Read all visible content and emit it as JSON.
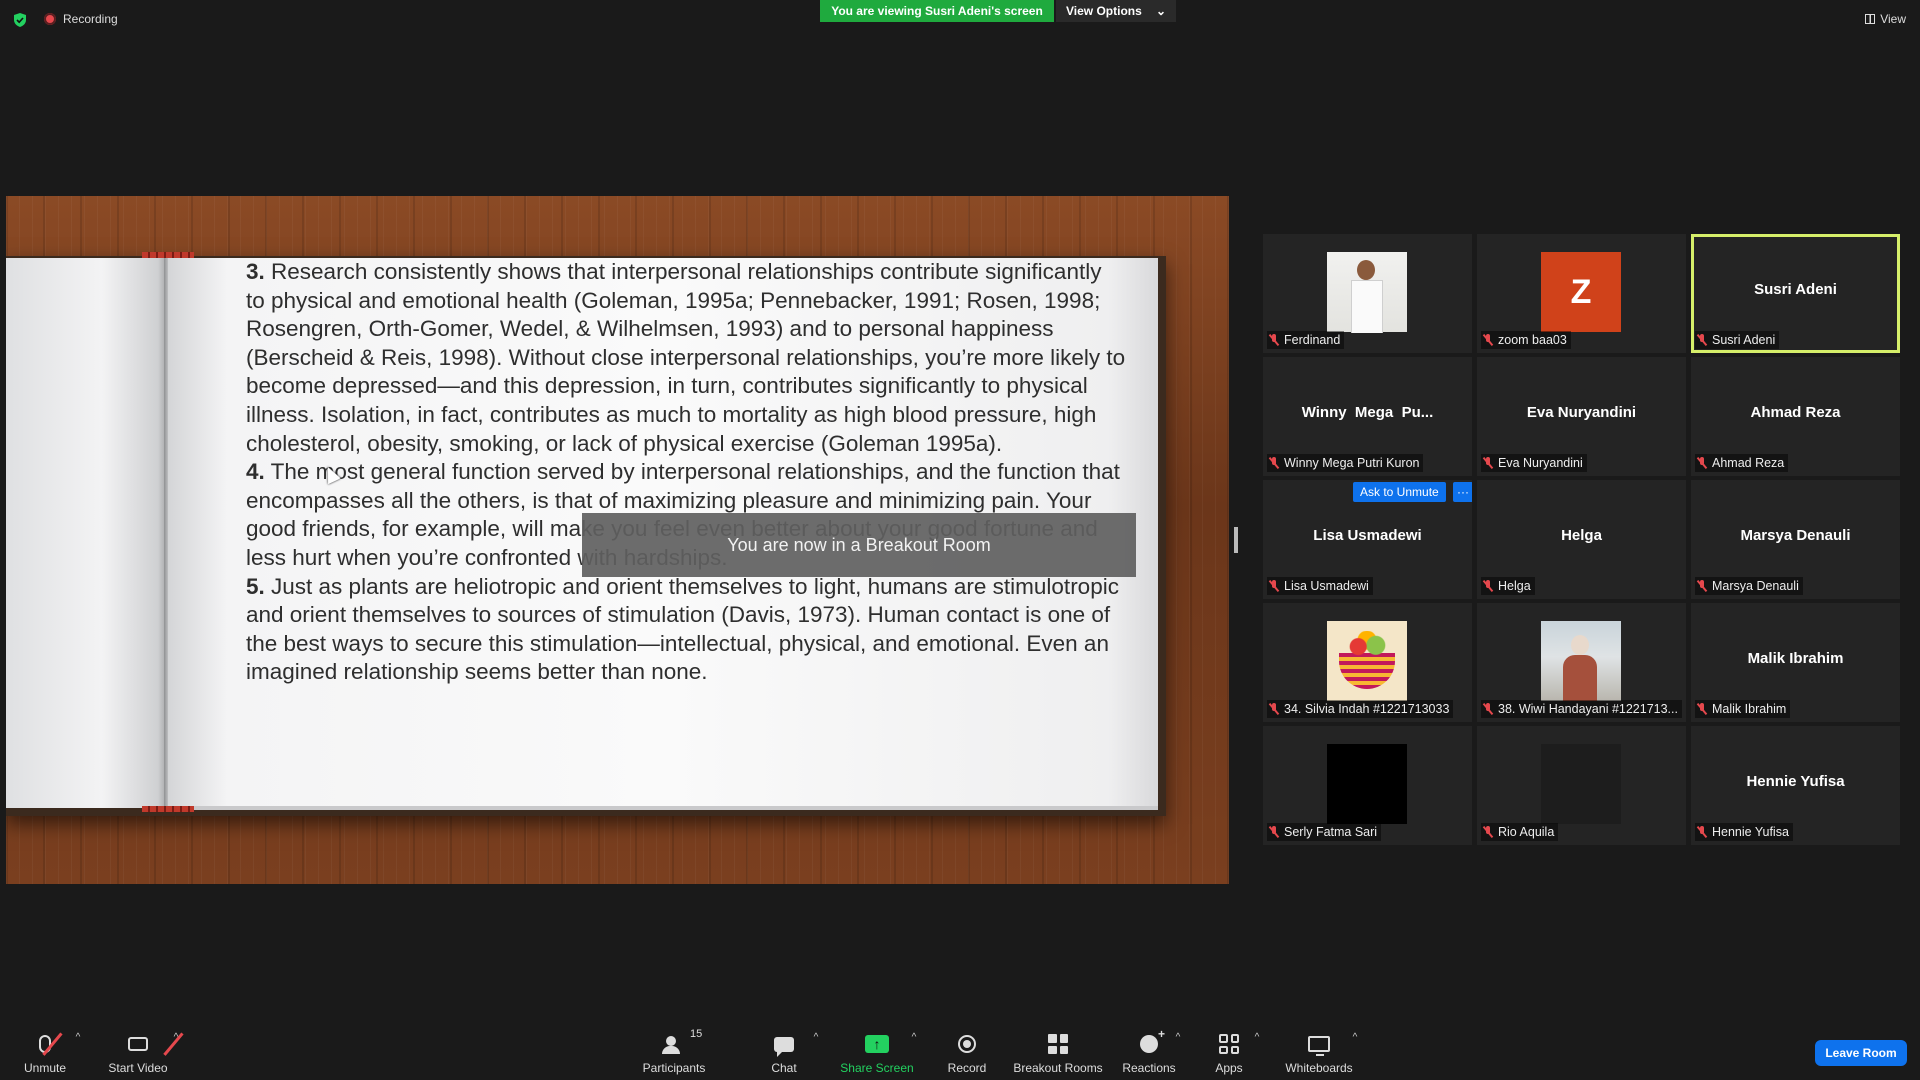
{
  "top": {
    "recording_label": "Recording",
    "viewing_banner": "You are viewing Susri Adeni's screen",
    "view_options": "View Options",
    "view_label": "View"
  },
  "share": {
    "p3_num": "3.",
    "p3_text": "Research consistently shows that interpersonal relationships contribute significantly to physical and emotional health (Goleman, 1995a; Pennebacker, 1991; Rosen, 1998; Rosengren, Orth-Gomer, Wedel, & Wilhelmsen, 1993) and to personal happiness (Berscheid & Reis, 1998). Without close interpersonal relationships, you’re more likely to become depressed—and this depression, in turn, contributes significantly to physical illness. Isolation, in fact, contributes as much to mortality as high blood pressure, high cholesterol, obesity, smoking, or lack of physical exercise (Goleman 1995a).",
    "p4_num": "4.",
    "p4_text": "The most general function served by interpersonal relationships, and the function that encompasses all the others, is that of maximizing pleasure and minimizing pain. Your good friends, for example, will make you feel even better about your good fortune and less hurt when you’re confronted with hardships.",
    "p5_num": "5.",
    "p5_text": "Just as plants are heliotropic and orient themselves to light, humans are stimulotropic and orient themselves to sources of stimulation (Davis, 1973). Human contact is one of the best ways to secure this stimulation—intellectual, physical, and emotional. Even an imagined relationship seems better than none.",
    "toast": "You are now in a Breakout Room"
  },
  "participants": [
    {
      "label": "Ferdinand",
      "name": "",
      "avatar": "photo-man-white-shirt"
    },
    {
      "label": "zoom baa03",
      "name": "",
      "avatar_letter": "Z"
    },
    {
      "label": "Susri Adeni",
      "name": "Susri Adeni",
      "active": true
    },
    {
      "label": "Winny Mega Putri Kuron",
      "name": "Winny  Mega  Pu..."
    },
    {
      "label": "Eva Nuryandini",
      "name": "Eva Nuryandini"
    },
    {
      "label": "Ahmad Reza",
      "name": "Ahmad Reza"
    },
    {
      "label": "Lisa Usmadewi",
      "name": "Lisa Usmadewi",
      "ask_unmute": "Ask to Unmute",
      "more": "···"
    },
    {
      "label": "Helga",
      "name": "Helga"
    },
    {
      "label": "Marsya Denauli",
      "name": "Marsya Denauli"
    },
    {
      "label": "34. Silvia Indah #1221713033",
      "name": "",
      "avatar": "fruit-basket"
    },
    {
      "label": "38. Wiwi Handayani #1221713...",
      "name": "",
      "avatar": "photo-woman"
    },
    {
      "label": "Malik Ibrahim",
      "name": "Malik Ibrahim"
    },
    {
      "label": "Serly Fatma Sari",
      "name": "",
      "avatar": "black"
    },
    {
      "label": "Rio Aquila",
      "name": "",
      "avatar": "dark"
    },
    {
      "label": "Hennie Yufisa",
      "name": "Hennie Yufisa"
    }
  ],
  "toolbar": {
    "unmute": "Unmute",
    "start_video": "Start Video",
    "participants": "Participants",
    "participants_count": "15",
    "chat": "Chat",
    "share_screen": "Share Screen",
    "share_arrow": "↑",
    "record": "Record",
    "breakout_rooms": "Breakout Rooms",
    "reactions": "Reactions",
    "apps": "Apps",
    "whiteboards": "Whiteboards",
    "leave_room": "Leave Room",
    "caret": "^"
  },
  "colors": {
    "banner_green": "#1faa3e",
    "active_border": "#d6ef6a",
    "primary_blue": "#0e72ed",
    "mute_red": "#e5484d"
  }
}
